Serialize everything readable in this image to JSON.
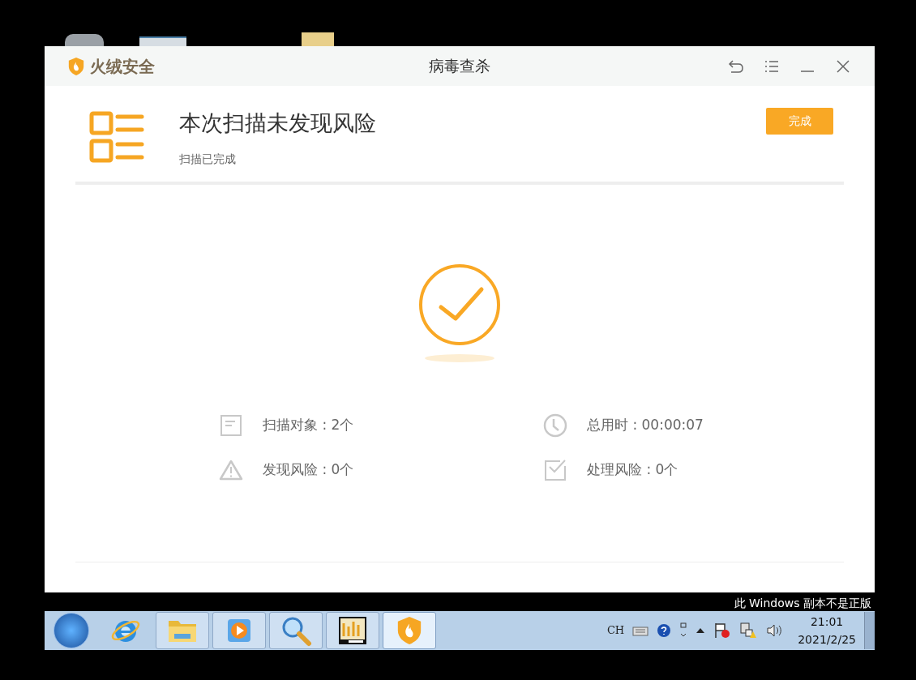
{
  "window": {
    "brand": "火绒安全",
    "title": "病毒查杀"
  },
  "result": {
    "title": "本次扫描未发现风险",
    "subtitle": "扫描已完成",
    "button": "完成"
  },
  "stats": [
    {
      "kind": "objects",
      "text": "扫描对象 : 2个"
    },
    {
      "kind": "time",
      "text": "总用时 : 00:00:07"
    },
    {
      "kind": "risk",
      "text": "发现风险 : 0个"
    },
    {
      "kind": "handled",
      "text": "处理风险 : 0个"
    }
  ],
  "notice": "此 Windows 副本不是正版",
  "taskbar": {
    "apps": [
      {
        "kind": "ie",
        "selected": false
      },
      {
        "kind": "explorer",
        "selected": false
      },
      {
        "kind": "media",
        "selected": false
      },
      {
        "kind": "search",
        "selected": false
      },
      {
        "kind": "monitor",
        "selected": false
      },
      {
        "kind": "shield",
        "selected": true
      }
    ],
    "language": "CH",
    "time": "21:01",
    "date": "2021/2/25"
  }
}
